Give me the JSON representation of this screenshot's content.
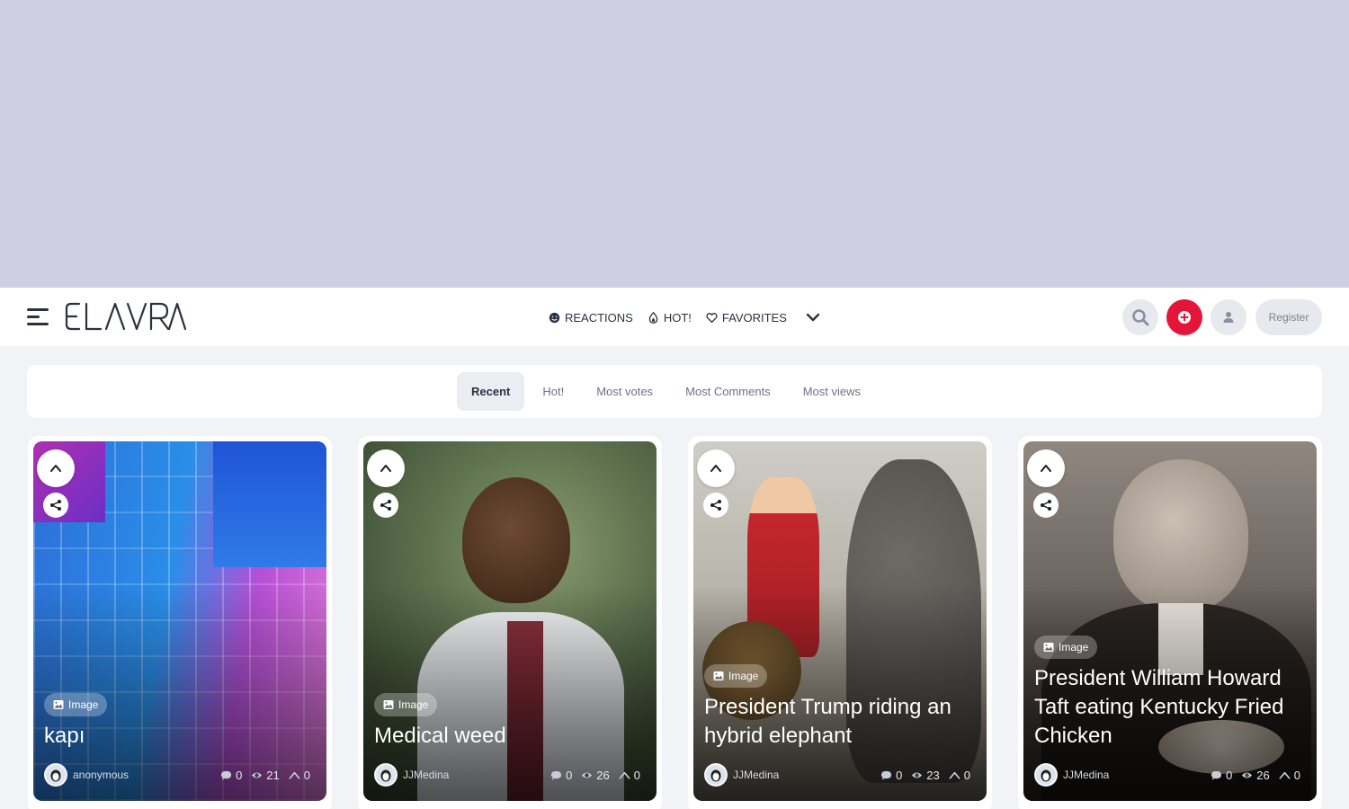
{
  "header": {
    "logo_text": "ELAVRA",
    "nav": [
      {
        "label": "REACTIONS",
        "icon": "smiley-icon"
      },
      {
        "label": "HOT!",
        "icon": "flame-icon"
      },
      {
        "label": "FAVORITES",
        "icon": "heart-icon"
      }
    ],
    "register_label": "Register"
  },
  "tabs": [
    {
      "label": "Recent",
      "active": true
    },
    {
      "label": "Hot!",
      "active": false
    },
    {
      "label": "Most votes",
      "active": false
    },
    {
      "label": "Most Comments",
      "active": false
    },
    {
      "label": "Most views",
      "active": false
    }
  ],
  "cards": [
    {
      "badge": "Image",
      "title": "kapı",
      "author": "anonymous",
      "comments": "0",
      "views": "21",
      "votes": "0"
    },
    {
      "badge": "Image",
      "title": "Medical weed",
      "author": "JJMedina",
      "comments": "0",
      "views": "26",
      "votes": "0"
    },
    {
      "badge": "Image",
      "title": "President Trump riding an hybrid elephant",
      "author": "JJMedina",
      "comments": "0",
      "views": "23",
      "votes": "0"
    },
    {
      "badge": "Image",
      "title": "President William Howard Taft eating Kentucky Fried Chicken",
      "author": "JJMedina",
      "comments": "0",
      "views": "26",
      "votes": "0"
    }
  ],
  "colors": {
    "accent": "#e5153a",
    "ad_background": "#cfcfe1",
    "page_background": "#f2f3f7"
  }
}
